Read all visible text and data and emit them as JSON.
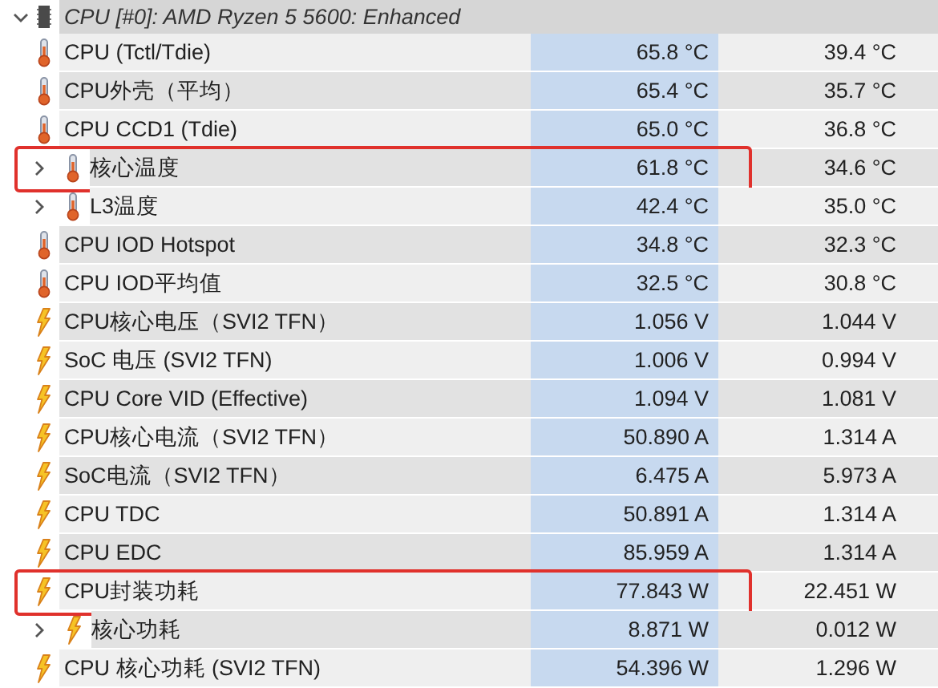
{
  "header": {
    "title": "CPU [#0]: AMD Ryzen 5 5600: Enhanced",
    "expanded": true
  },
  "rows": [
    {
      "label": "CPU (Tctl/Tdie)",
      "kind": "temperature",
      "current": "65.8 °C",
      "column_3": "39.4 °C",
      "highlighted": false
    },
    {
      "label": "CPU外壳（平均）",
      "kind": "temperature",
      "current": "65.4 °C",
      "column_3": "35.7 °C",
      "highlighted": false
    },
    {
      "label": "CPU CCD1 (Tdie)",
      "kind": "temperature",
      "current": "65.0 °C",
      "column_3": "36.8 °C",
      "highlighted": false
    },
    {
      "label": "核心温度",
      "kind": "temperature",
      "expanded": false,
      "current": "61.8 °C",
      "column_3": "34.6 °C",
      "highlighted": true
    },
    {
      "label": "L3温度",
      "kind": "temperature",
      "expanded": false,
      "current": "42.4 °C",
      "column_3": "35.0 °C",
      "highlighted": false
    },
    {
      "label": "CPU IOD Hotspot",
      "kind": "temperature",
      "current": "34.8 °C",
      "column_3": "32.3 °C",
      "highlighted": false
    },
    {
      "label": "CPU IOD平均值",
      "kind": "temperature",
      "current": "32.5 °C",
      "column_3": "30.8 °C",
      "highlighted": false
    },
    {
      "label": "CPU核心电压（SVI2 TFN）",
      "kind": "electrical",
      "current": "1.056 V",
      "column_3": "1.044 V",
      "highlighted": false
    },
    {
      "label": "SoC 电压 (SVI2 TFN)",
      "kind": "electrical",
      "current": "1.006 V",
      "column_3": "0.994 V",
      "highlighted": false
    },
    {
      "label": "CPU Core VID (Effective)",
      "kind": "electrical",
      "current": "1.094 V",
      "column_3": "1.081 V",
      "highlighted": false
    },
    {
      "label": "CPU核心电流（SVI2 TFN）",
      "kind": "electrical",
      "current": "50.890 A",
      "column_3": "1.314 A",
      "highlighted": false
    },
    {
      "label": "SoC电流（SVI2 TFN）",
      "kind": "electrical",
      "current": "6.475 A",
      "column_3": "5.973 A",
      "highlighted": false
    },
    {
      "label": "CPU TDC",
      "kind": "electrical",
      "current": "50.891 A",
      "column_3": "1.314 A",
      "highlighted": false
    },
    {
      "label": "CPU EDC",
      "kind": "electrical",
      "current": "85.959 A",
      "column_3": "1.314 A",
      "highlighted": false
    },
    {
      "label": "CPU封装功耗",
      "kind": "electrical",
      "current": "77.843 W",
      "column_3": "22.451 W",
      "highlighted": true
    },
    {
      "label": "核心功耗",
      "kind": "electrical",
      "expanded": false,
      "current": "8.871 W",
      "column_3": "0.012 W",
      "highlighted": false
    },
    {
      "label": "CPU 核心功耗 (SVI2 TFN)",
      "kind": "electrical",
      "current": "54.396 W",
      "column_3": "1.296 W",
      "highlighted": false
    }
  ]
}
